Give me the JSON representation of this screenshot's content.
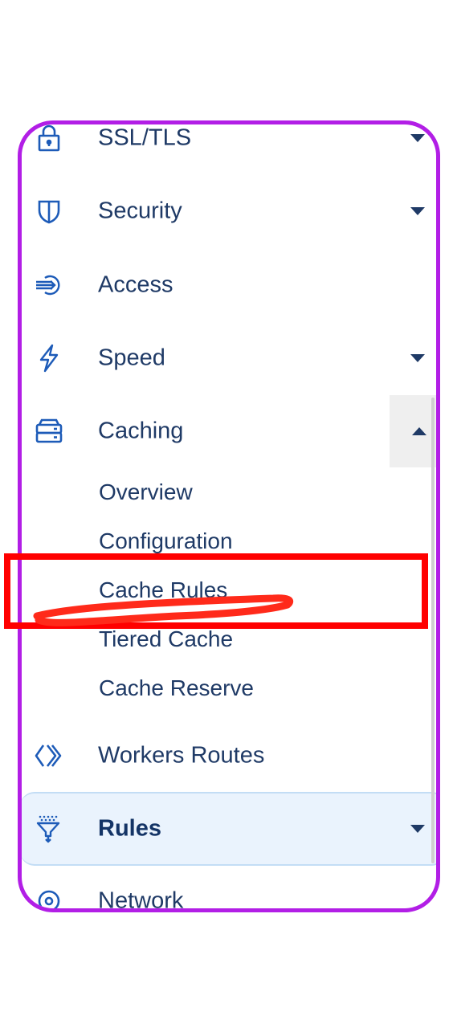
{
  "menu": {
    "items": [
      {
        "label": "SSL/TLS",
        "icon": "lock-icon",
        "expandable": true
      },
      {
        "label": "Security",
        "icon": "shield-icon",
        "expandable": true
      },
      {
        "label": "Access",
        "icon": "access-arrow-icon",
        "expandable": false
      },
      {
        "label": "Speed",
        "icon": "lightning-icon",
        "expandable": true
      },
      {
        "label": "Caching",
        "icon": "server-stack-icon",
        "expandable": true,
        "expanded": true
      },
      {
        "label": "Workers Routes",
        "icon": "workers-icon",
        "expandable": false
      },
      {
        "label": "Rules",
        "icon": "funnel-icon",
        "expandable": true,
        "active": true
      },
      {
        "label": "Network",
        "icon": "network-icon",
        "expandable": false
      }
    ],
    "caching_subitems": [
      {
        "label": "Overview"
      },
      {
        "label": "Configuration"
      },
      {
        "label": "Cache Rules",
        "highlighted": true
      },
      {
        "label": "Tiered Cache"
      },
      {
        "label": "Cache Reserve"
      }
    ]
  },
  "colors": {
    "text": "#1f3a66",
    "icon": "#1d5bb8",
    "frame_annotation": "#b21ee6",
    "highlight_annotation": "#ff0000",
    "active_bg": "#eaf3fd"
  }
}
